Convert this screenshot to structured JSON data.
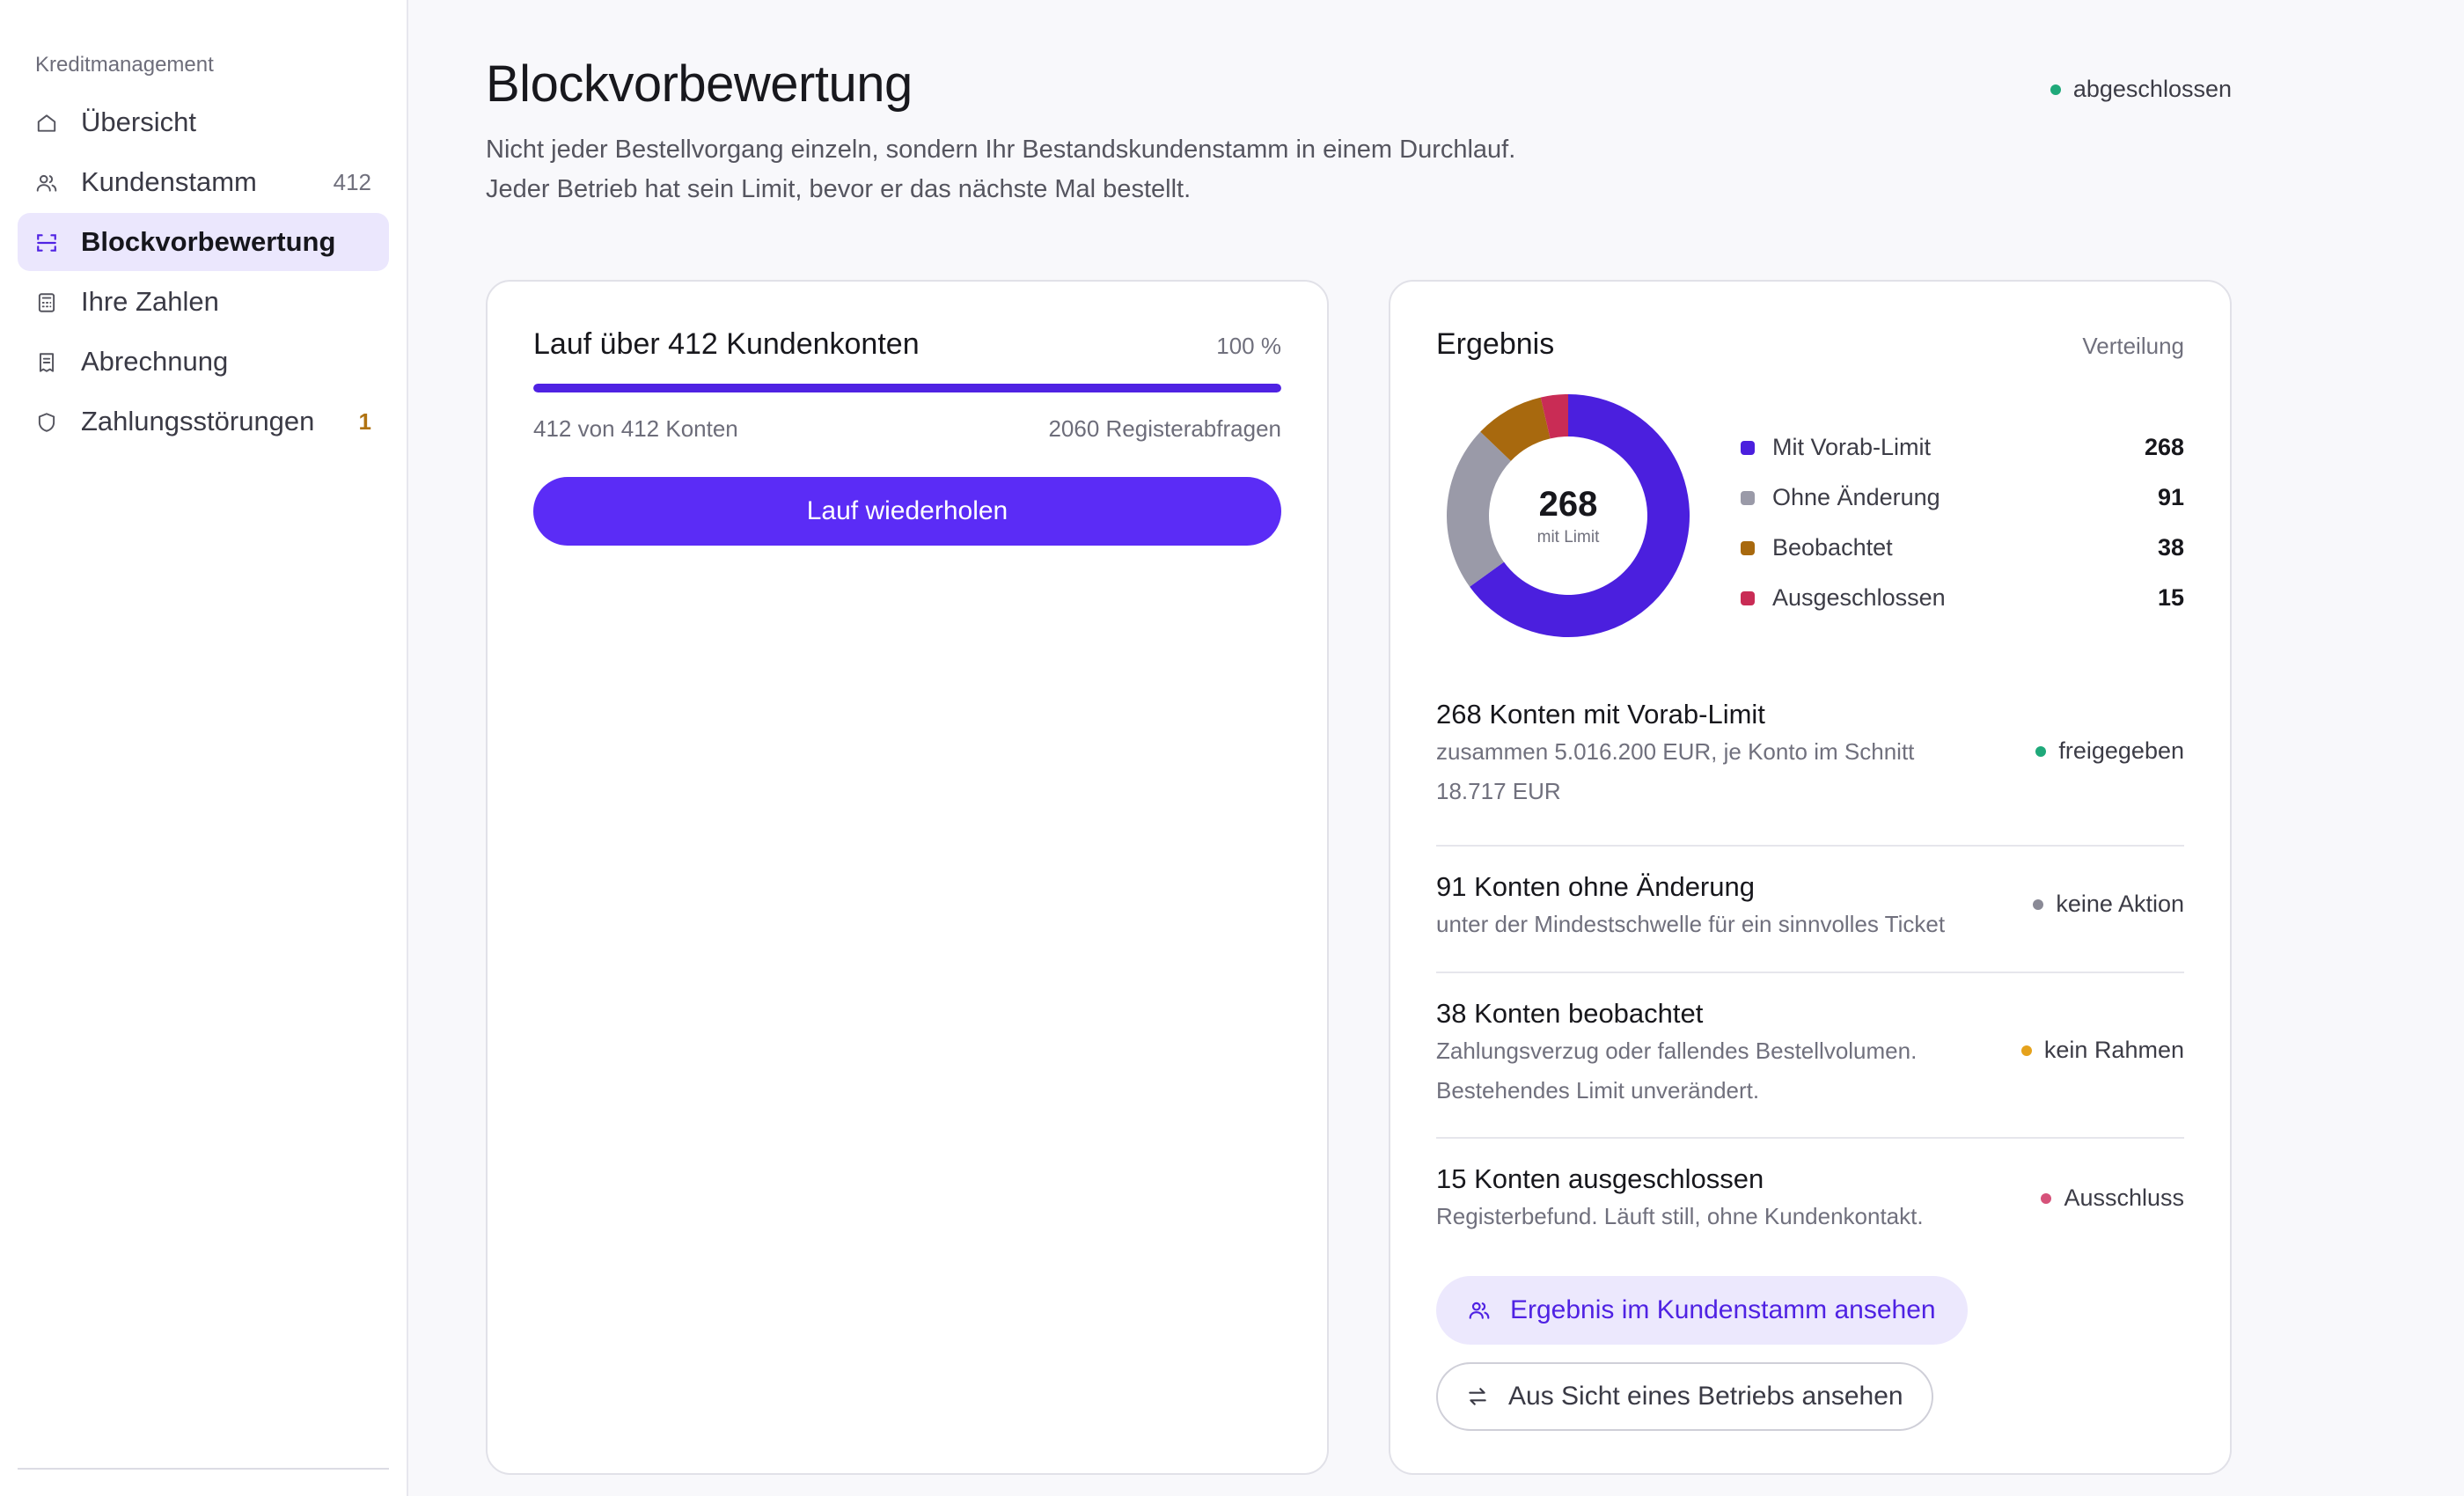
{
  "sidebar": {
    "heading": "Kreditmanagement",
    "items": [
      {
        "label": "Übersicht",
        "icon": "home-icon",
        "count": ""
      },
      {
        "label": "Kundenstamm",
        "icon": "users-icon",
        "count": "412"
      },
      {
        "label": "Blockvorbewertung",
        "icon": "scan-icon",
        "count": "",
        "active": true
      },
      {
        "label": "Ihre Zahlen",
        "icon": "calculator-icon",
        "count": ""
      },
      {
        "label": "Abrechnung",
        "icon": "receipt-icon",
        "count": ""
      },
      {
        "label": "Zahlungsstörungen",
        "icon": "shield-icon",
        "count": "1"
      }
    ]
  },
  "header": {
    "title": "Blockvorbewertung",
    "subtitle_line1": "Nicht jeder Bestellvorgang einzeln, sondern Ihr Bestandskundenstamm in einem Durchlauf.",
    "subtitle_line2": "Jeder Betrieb hat sein Limit, bevor er das nächste Mal bestellt.",
    "status": "abgeschlossen",
    "status_color": "#1fa97a"
  },
  "run": {
    "title": "Lauf über 412 Kundenkonten",
    "percent_label": "100 %",
    "progress": 1.0,
    "accounts_label": "412 von 412 Konten",
    "queries_label": "2060 Registerabfragen",
    "button_label": "Lauf wiederholen"
  },
  "result": {
    "title": "Ergebnis",
    "subtitle": "Verteilung",
    "center_value": "268",
    "center_label": "mit Limit",
    "segments": [
      {
        "name": "Mit Vorab-Limit",
        "value": 268,
        "color": "#4b1fde"
      },
      {
        "name": "Ohne Änderung",
        "value": 91,
        "color": "#9a9aa8"
      },
      {
        "name": "Beobachtet",
        "value": 38,
        "color": "#a8690e"
      },
      {
        "name": "Ausgeschlossen",
        "value": 15,
        "color": "#c92c55"
      }
    ],
    "rows": [
      {
        "title": "268 Konten mit Vorab-Limit",
        "desc": "zusammen 5.016.200 EUR, je Konto im Schnitt 18.717 EUR",
        "status": "freigegeben",
        "status_color": "#1fa97a"
      },
      {
        "title": "91 Konten ohne Änderung",
        "desc": "unter der Mindestschwelle für ein sinnvolles Ticket",
        "status": "keine Aktion",
        "status_color": "#8a8a96"
      },
      {
        "title": "38 Konten beobachtet",
        "desc": "Zahlungsverzug oder fallendes Bestellvolumen. Bestehendes Limit unverändert.",
        "status": "kein Rahmen",
        "status_color": "#e5a21c"
      },
      {
        "title": "15 Konten ausgeschlossen",
        "desc": "Registerbefund. Läuft still, ohne Kundenkontakt.",
        "status": "Ausschluss",
        "status_color": "#d6527a"
      }
    ],
    "btn_primary": "Ergebnis im Kundenstamm ansehen",
    "btn_secondary": "Aus Sicht eines Betriebs ansehen"
  }
}
